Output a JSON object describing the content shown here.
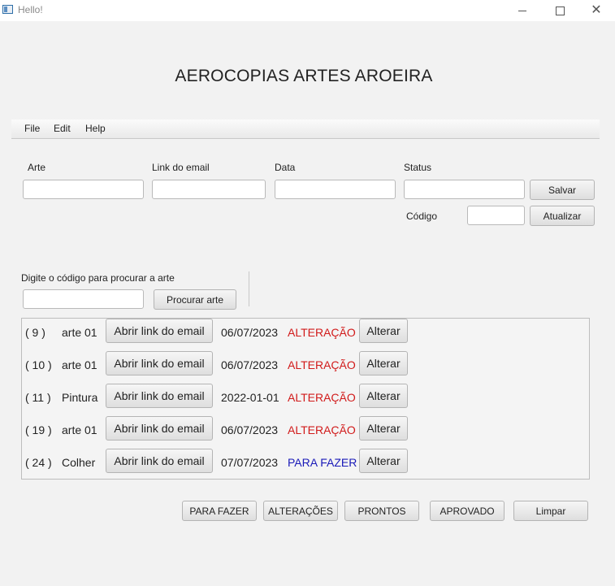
{
  "window": {
    "title": "Hello!"
  },
  "app_title": "AEROCOPIAS ARTES AROEIRA",
  "menu": [
    "File",
    "Edit",
    "Help"
  ],
  "form": {
    "arte_label": "Arte",
    "link_label": "Link do email",
    "data_label": "Data",
    "status_label": "Status",
    "codigo_label": "Código",
    "salvar": "Salvar",
    "atualizar": "Atualizar",
    "arte_value": "",
    "link_value": "",
    "data_value": "",
    "status_value": "",
    "codigo_value": ""
  },
  "search": {
    "label": "Digite o código para procurar a arte",
    "value": "",
    "button": "Procurar arte"
  },
  "rows": [
    {
      "id": "( 9 )",
      "name": "arte 01",
      "link_btn": "Abrir link do email",
      "date": "06/07/2023",
      "status": "ALTERAÇÃO",
      "alter_btn": "Alterar"
    },
    {
      "id": "( 10 )",
      "name": "arte 01",
      "link_btn": "Abrir link do email",
      "date": "06/07/2023",
      "status": "ALTERAÇÃO",
      "alter_btn": "Alterar"
    },
    {
      "id": "( 11 )",
      "name": "Pintura",
      "link_btn": "Abrir link do email",
      "date": "2022-01-01",
      "status": "ALTERAÇÃO",
      "alter_btn": "Alterar"
    },
    {
      "id": "( 19 )",
      "name": "arte 01",
      "link_btn": "Abrir link do email",
      "date": "06/07/2023",
      "status": "ALTERAÇÃO",
      "alter_btn": "Alterar"
    },
    {
      "id": "( 24 )",
      "name": "Colher",
      "link_btn": "Abrir link do email",
      "date": "07/07/2023",
      "status": "PARA FAZER",
      "alter_btn": "Alterar"
    }
  ],
  "status_colors": {
    "ALTERAÇÃO": "#d11a1a",
    "PARA FAZER": "#1a1ab8"
  },
  "filters": {
    "para_fazer": "PARA FAZER",
    "alteracoes": "ALTERAÇÕES",
    "prontos": "PRONTOS",
    "aprovado": "APROVADO",
    "limpar": "Limpar"
  }
}
